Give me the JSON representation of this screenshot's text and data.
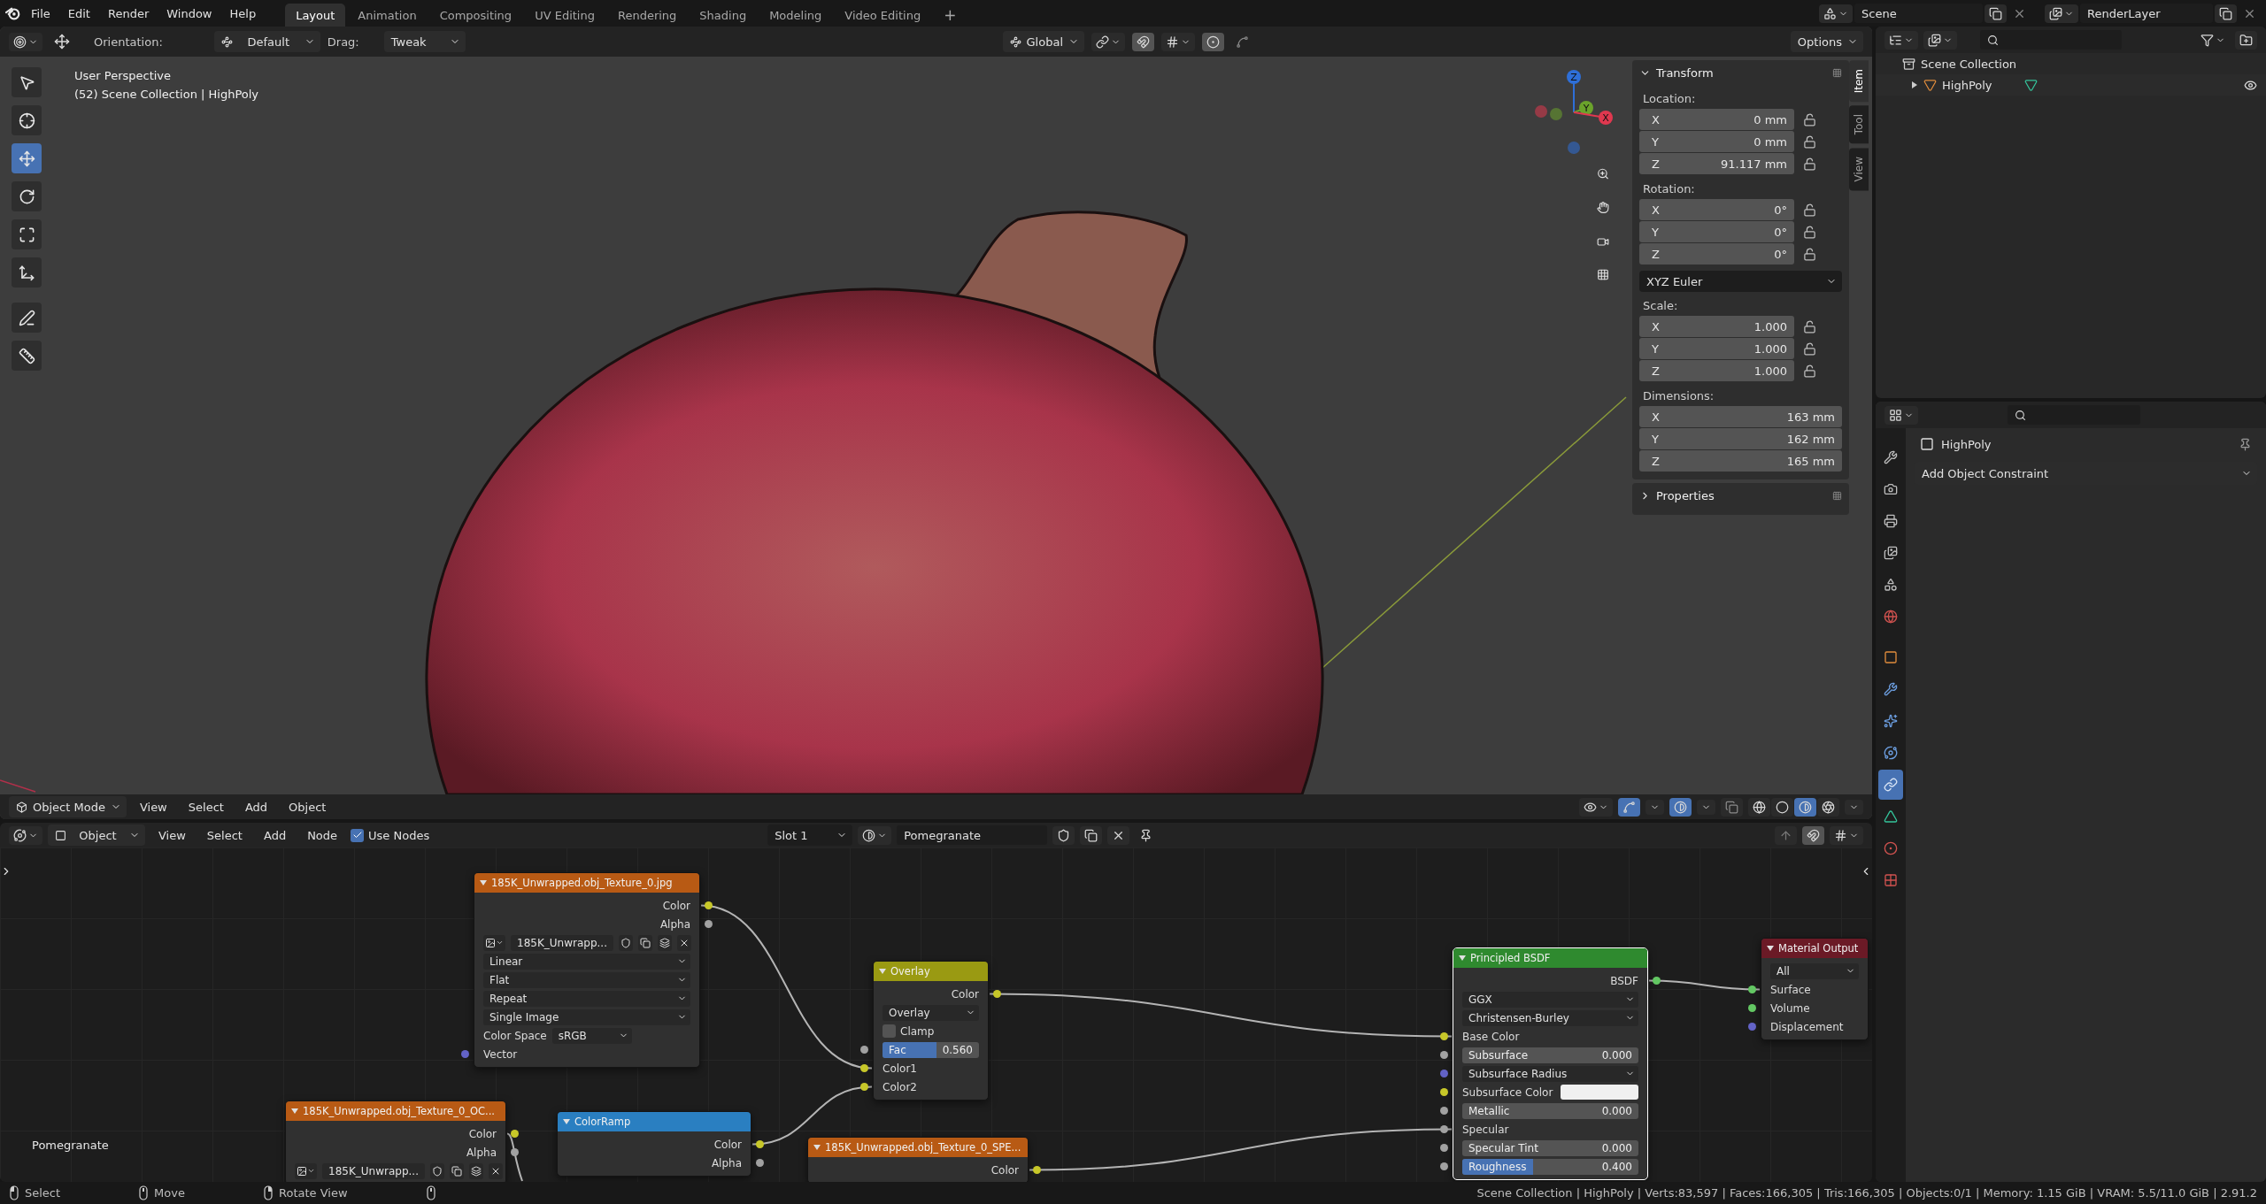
{
  "topbar": {
    "menus": [
      "File",
      "Edit",
      "Render",
      "Window",
      "Help"
    ],
    "workspaces": [
      {
        "label": "Layout",
        "selected": true
      },
      {
        "label": "Animation",
        "selected": false
      },
      {
        "label": "Compositing",
        "selected": false
      },
      {
        "label": "UV Editing",
        "selected": false
      },
      {
        "label": "Rendering",
        "selected": false
      },
      {
        "label": "Shading",
        "selected": false
      },
      {
        "label": "Modeling",
        "selected": false
      },
      {
        "label": "Video Editing",
        "selected": false
      }
    ],
    "add_workspace": "+",
    "scene": "Scene",
    "view_layer": "RenderLayer"
  },
  "tool_header": {
    "orientation_label": "Orientation:",
    "orientation": "Default",
    "drag_label": "Drag:",
    "drag": "Tweak",
    "transform_orientation": "Global",
    "options": "Options"
  },
  "toolbar": [
    {
      "kind": "select_box",
      "selected": false
    },
    {
      "kind": "cursor",
      "selected": false
    },
    {
      "kind": "move",
      "selected": true
    },
    {
      "kind": "rotate",
      "selected": false
    },
    {
      "kind": "scale",
      "selected": false
    },
    {
      "kind": "transform",
      "selected": false
    },
    {
      "kind": "annotate",
      "selected": false
    },
    {
      "kind": "measure",
      "selected": false
    }
  ],
  "viewport": {
    "view_name": "User Perspective",
    "collection_info": "(52) Scene Collection | HighPoly",
    "gizmo_axes": [
      {
        "label": "Z",
        "color": "#2e6fd8"
      },
      {
        "label": "Y",
        "color": "#6ba32b"
      },
      {
        "label": "X",
        "color": "#e0384f"
      }
    ]
  },
  "sidebar": {
    "tabs": [
      {
        "label": "Item",
        "selected": true
      },
      {
        "label": "Tool",
        "selected": false
      },
      {
        "label": "View",
        "selected": false
      }
    ],
    "panels": [
      {
        "title": "Transform",
        "expanded": true,
        "groups": [
          {
            "kind": "vector",
            "label": "Location:",
            "lockable": true,
            "fields": [
              {
                "axis": "X",
                "value": "0 mm"
              },
              {
                "axis": "Y",
                "value": "0 mm"
              },
              {
                "axis": "Z",
                "value": "91.117 mm"
              }
            ]
          },
          {
            "kind": "vector",
            "label": "Rotation:",
            "lockable": true,
            "fields": [
              {
                "axis": "X",
                "value": "0°"
              },
              {
                "axis": "Y",
                "value": "0°"
              },
              {
                "axis": "Z",
                "value": "0°"
              }
            ]
          },
          {
            "kind": "dropdown",
            "value": "XYZ Euler"
          },
          {
            "kind": "vector",
            "label": "Scale:",
            "lockable": true,
            "fields": [
              {
                "axis": "X",
                "value": "1.000"
              },
              {
                "axis": "Y",
                "value": "1.000"
              },
              {
                "axis": "Z",
                "value": "1.000"
              }
            ]
          },
          {
            "kind": "vector",
            "label": "Dimensions:",
            "lockable": false,
            "fields": [
              {
                "axis": "X",
                "value": "163 mm"
              },
              {
                "axis": "Y",
                "value": "162 mm"
              },
              {
                "axis": "Z",
                "value": "165 mm"
              }
            ]
          }
        ]
      },
      {
        "title": "Properties",
        "expanded": false
      }
    ]
  },
  "viewport_header": {
    "mode": "Object Mode",
    "menus": [
      "View",
      "Select",
      "Add",
      "Object"
    ],
    "gizmos_on": true,
    "overlays_on": true,
    "xray_on": false,
    "shading": [
      {
        "kind": "wireframe",
        "selected": false
      },
      {
        "kind": "solid",
        "selected": false
      },
      {
        "kind": "material",
        "selected": true
      },
      {
        "kind": "rendered",
        "selected": false
      }
    ]
  },
  "node_editor": {
    "header": {
      "object_type": "Object",
      "menus": [
        "View",
        "Select",
        "Add",
        "Node"
      ],
      "use_nodes": {
        "label": "Use Nodes",
        "checked": true
      },
      "slot": "Slot 1",
      "material": "Pomegranate"
    },
    "material_label": "Pomegranate",
    "nodes": [
      {
        "title": "185K_Unwrapped.obj_Texture_0.jpg",
        "color": "#b85a14",
        "selected": false,
        "rows": [
          {
            "kind": "output",
            "label": "Color",
            "color": "#c7c729"
          },
          {
            "kind": "output",
            "label": "Alpha",
            "color": "#a1a1a1"
          },
          {
            "kind": "image",
            "value": "185K_Unwrapp..."
          },
          {
            "kind": "dropdown",
            "value": "Linear"
          },
          {
            "kind": "dropdown",
            "value": "Flat"
          },
          {
            "kind": "dropdown",
            "value": "Repeat"
          },
          {
            "kind": "dropdown",
            "value": "Single Image"
          },
          {
            "kind": "labeled_dropdown",
            "label": "Color Space",
            "value": "sRGB"
          },
          {
            "kind": "input",
            "label": "Vector",
            "color": "#6363c7"
          }
        ]
      },
      {
        "title": "185K_Unwrapped.obj_Texture_0_OC...",
        "color": "#b85a14",
        "selected": false,
        "rows": [
          {
            "kind": "output",
            "label": "Color",
            "color": "#c7c729"
          },
          {
            "kind": "output",
            "label": "Alpha",
            "color": "#a1a1a1"
          },
          {
            "kind": "image",
            "value": "185K_Unwrapp..."
          }
        ]
      },
      {
        "title": "ColorRamp",
        "color": "#2a7fc1",
        "selected": false,
        "rows": [
          {
            "kind": "output",
            "label": "Color",
            "color": "#c7c729"
          },
          {
            "kind": "output",
            "label": "Alpha",
            "color": "#a1a1a1"
          }
        ]
      },
      {
        "title": "Overlay",
        "color": "#9a9a12",
        "selected": false,
        "rows": [
          {
            "kind": "output",
            "label": "Color",
            "color": "#c7c729"
          },
          {
            "kind": "dropdown",
            "value": "Overlay"
          },
          {
            "kind": "checkbox",
            "label": "Clamp",
            "checked": false
          },
          {
            "kind": "slider",
            "label": "Fac",
            "value": "0.560",
            "level": 0.56,
            "color": "#a1a1a1"
          },
          {
            "kind": "input",
            "label": "Color1",
            "color": "#c7c729"
          },
          {
            "kind": "input",
            "label": "Color2",
            "color": "#c7c729"
          }
        ]
      },
      {
        "title": "185K_Unwrapped.obj_Texture_0_SPE...",
        "color": "#b85a14",
        "selected": false,
        "rows": [
          {
            "kind": "output",
            "label": "Color",
            "color": "#c7c729"
          }
        ]
      },
      {
        "title": "Principled BSDF",
        "color": "#2f8a2f",
        "selected": true,
        "rows": [
          {
            "kind": "output",
            "label": "BSDF",
            "color": "#63c763"
          },
          {
            "kind": "dropdown",
            "value": "GGX"
          },
          {
            "kind": "dropdown",
            "value": "Christensen-Burley"
          },
          {
            "kind": "input",
            "label": "Base Color",
            "color": "#c7c729"
          },
          {
            "kind": "number",
            "label": "Subsurface",
            "value": "0.000",
            "color": "#a1a1a1"
          },
          {
            "kind": "dropdown",
            "value": "Subsurface Radius",
            "color": "#6363c7"
          },
          {
            "kind": "color_input",
            "label": "Subsurface Color",
            "swatch": {
              "color": "#f0f0f0"
            },
            "color": "#c7c729"
          },
          {
            "kind": "number",
            "label": "Metallic",
            "value": "0.000",
            "color": "#a1a1a1"
          },
          {
            "kind": "input",
            "label": "Specular",
            "color": "#a1a1a1"
          },
          {
            "kind": "number",
            "label": "Specular Tint",
            "value": "0.000",
            "color": "#a1a1a1"
          },
          {
            "kind": "slider",
            "label": "Roughness",
            "value": "0.400",
            "level": 0.4,
            "color": "#a1a1a1"
          }
        ]
      },
      {
        "title": "Material Output",
        "color": "#6b1a26",
        "selected": false,
        "rows": [
          {
            "kind": "dropdown",
            "value": "All"
          },
          {
            "kind": "input",
            "label": "Surface",
            "color": "#63c763"
          },
          {
            "kind": "input",
            "label": "Volume",
            "color": "#63c763"
          },
          {
            "kind": "input",
            "label": "Displacement",
            "color": "#6363c7"
          }
        ]
      }
    ]
  },
  "outliner": {
    "root": "Scene Collection",
    "items": [
      {
        "label": "HighPoly",
        "expanded": false,
        "visible": true
      }
    ]
  },
  "properties": {
    "tabs": [
      {
        "kind": "tool",
        "selected": false
      },
      {
        "kind": "render",
        "selected": false
      },
      {
        "kind": "output",
        "selected": false
      },
      {
        "kind": "view_layer",
        "selected": false
      },
      {
        "kind": "scene",
        "selected": false
      },
      {
        "kind": "world",
        "selected": false
      },
      {
        "kind": "object",
        "selected": false
      },
      {
        "kind": "modifiers",
        "selected": false
      },
      {
        "kind": "particles",
        "selected": false
      },
      {
        "kind": "physics",
        "selected": false
      },
      {
        "kind": "constraints",
        "selected": true
      },
      {
        "kind": "data",
        "selected": false
      },
      {
        "kind": "material",
        "selected": false
      },
      {
        "kind": "texture",
        "selected": false
      }
    ],
    "object_name": "HighPoly",
    "add_constraint": "Add Object Constraint"
  },
  "status_bar": {
    "hints": [
      {
        "kind": "mouse_left",
        "label": "Select"
      },
      {
        "kind": "mouse_middle",
        "label": "Move"
      },
      {
        "kind": "mouse_right",
        "label": "Rotate View"
      },
      {
        "kind": "mouse_middle"
      }
    ],
    "stats": "Scene Collection | HighPoly | Verts:83,597 | Faces:166,305 | Tris:166,305 | Objects:0/1 | Memory: 1.15 GiB | VRAM: 5.5/11.0 GiB | 2.91.2"
  }
}
